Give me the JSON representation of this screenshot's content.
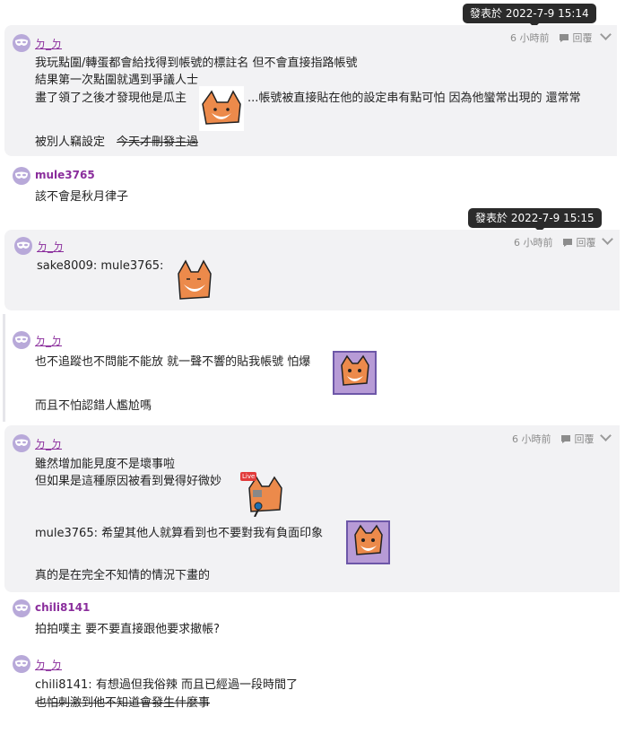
{
  "tooltips": [
    "發表於 2022-7-9 15:14",
    "發表於 2022-7-9 15:15"
  ],
  "comments": [
    {
      "user": "ㄉ_ㄉ",
      "time": "6 小時前",
      "reply": "回覆",
      "lines": [
        "我玩點圍/轉蛋都會給找得到帳號的標註名 但不會直接指路帳號",
        "結果第一次點圍就遇到爭議人士",
        "畫了領了之後才發現他是瓜主",
        "...帳號被直接貼在他的設定串有點可怕 因為他蠻常出現的 還常常",
        "被別人竊設定",
        "今天才刪發主過"
      ]
    },
    {
      "user": "mule3765",
      "lines": [
        "該不會是秋月律子"
      ]
    },
    {
      "user": "ㄉ_ㄉ",
      "time": "6 小時前",
      "reply": "回覆",
      "lines": [
        "sake8009: mule3765:"
      ]
    },
    {
      "user": "ㄉ_ㄉ",
      "lines": [
        "也不追蹤也不問能不能放 就一聲不響的貼我帳號 怕爆",
        "而且不怕認錯人尷尬嗎"
      ]
    },
    {
      "user": "ㄉ_ㄉ",
      "time": "6 小時前",
      "reply": "回覆",
      "lines": [
        "雖然增加能見度不是壞事啦",
        "但如果是這種原因被看到覺得好微妙",
        "mule3765: 希望其他人就算看到也不要對我有負面印象",
        "真的是在完全不知情的情況下畫的"
      ],
      "live_badge": "Live"
    },
    {
      "user": "chili8141",
      "lines": [
        "拍拍噗主 要不要直接跟他要求撤帳?"
      ]
    },
    {
      "user": "ㄉ_ㄉ",
      "lines": [
        "chili8141: 有想過但我俗辣 而且已經過一段時間了",
        "也怕刺激到他不知道會發生什麼事"
      ]
    }
  ],
  "icons": {
    "avatar": "mask-icon",
    "reply": "speech-bubble-icon",
    "more": "chevron-down-icon"
  },
  "colors": {
    "username": "#8a2d9c",
    "card": "#f2f2f4",
    "tooltip": "#2b2b2b",
    "avatar": "#b8a9d9"
  }
}
